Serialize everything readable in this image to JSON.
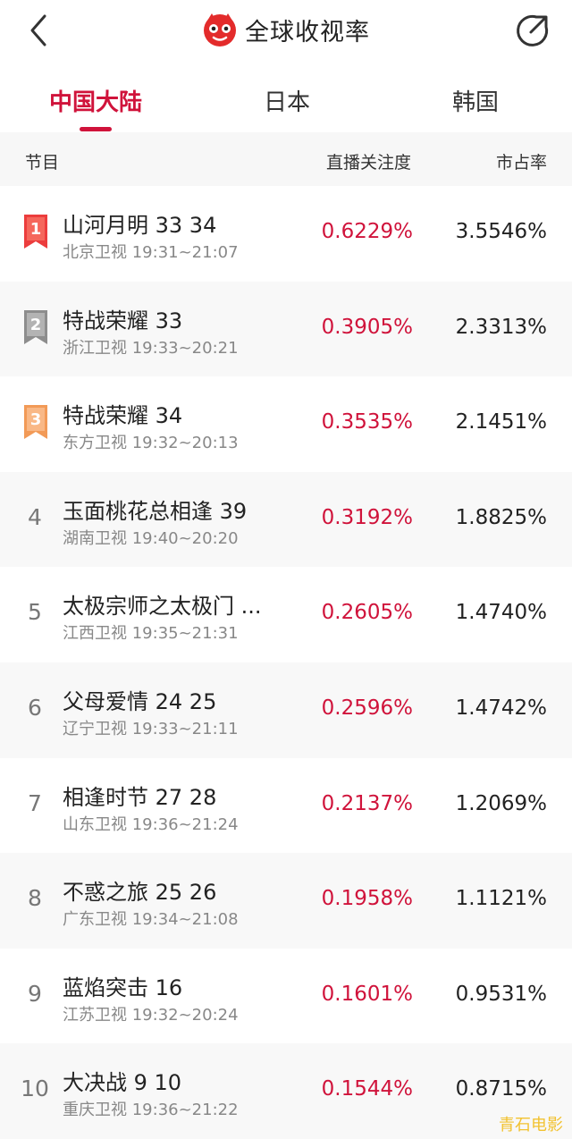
{
  "header": {
    "title": "全球收视率",
    "back_icon": "back-chevron-icon",
    "logo_icon": "cat-logo-icon",
    "share_icon": "share-icon",
    "brand_color": "#d0133b"
  },
  "tabs": [
    {
      "label": "中国大陆",
      "active": true
    },
    {
      "label": "日本",
      "active": false
    },
    {
      "label": "韩国",
      "active": false
    }
  ],
  "table": {
    "headers": {
      "program": "节目",
      "attention": "直播关注度",
      "share": "市占率"
    },
    "rows": [
      {
        "rank": "1",
        "title": "山河月明 33 34",
        "channel_time": "北京卫视 19:31~21:07",
        "attention": "0.6229%",
        "share": "3.5546%"
      },
      {
        "rank": "2",
        "title": "特战荣耀 33",
        "channel_time": "浙江卫视 19:33~20:21",
        "attention": "0.3905%",
        "share": "2.3313%"
      },
      {
        "rank": "3",
        "title": "特战荣耀 34",
        "channel_time": "东方卫视 19:32~20:13",
        "attention": "0.3535%",
        "share": "2.1451%"
      },
      {
        "rank": "4",
        "title": "玉面桃花总相逢 39",
        "channel_time": "湖南卫视 19:40~20:20",
        "attention": "0.3192%",
        "share": "1.8825%"
      },
      {
        "rank": "5",
        "title": "太极宗师之太极门 ...",
        "channel_time": "江西卫视 19:35~21:31",
        "attention": "0.2605%",
        "share": "1.4740%"
      },
      {
        "rank": "6",
        "title": "父母爱情 24 25",
        "channel_time": "辽宁卫视 19:33~21:11",
        "attention": "0.2596%",
        "share": "1.4742%"
      },
      {
        "rank": "7",
        "title": "相逢时节 27 28",
        "channel_time": "山东卫视 19:36~21:24",
        "attention": "0.2137%",
        "share": "1.2069%"
      },
      {
        "rank": "8",
        "title": "不惑之旅 25 26",
        "channel_time": "广东卫视 19:34~21:08",
        "attention": "0.1958%",
        "share": "1.1121%"
      },
      {
        "rank": "9",
        "title": "蓝焰突击 16",
        "channel_time": "江苏卫视 19:32~20:24",
        "attention": "0.1601%",
        "share": "0.9531%"
      },
      {
        "rank": "10",
        "title": "大决战 9 10",
        "channel_time": "重庆卫视 19:36~21:22",
        "attention": "0.1544%",
        "share": "0.8715%"
      }
    ]
  },
  "watermark": "青石电影"
}
